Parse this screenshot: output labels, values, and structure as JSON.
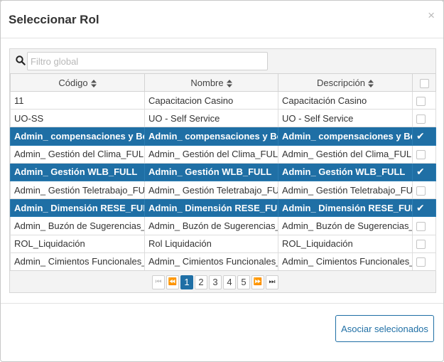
{
  "dialog": {
    "title": "Seleccionar Rol",
    "close_glyph": "×"
  },
  "filter": {
    "placeholder": "Filtro global",
    "icon": "search-icon"
  },
  "table": {
    "columns": [
      "Código",
      "Nombre",
      "Descripción"
    ],
    "rows": [
      {
        "codigo": "11",
        "nombre": "Capacitacion Casino",
        "descripcion": "Capacitación Casino",
        "selected": false
      },
      {
        "codigo": "UO-SS",
        "nombre": "UO - Self Service",
        "descripcion": "UO - Self Service",
        "selected": false
      },
      {
        "codigo": "Admin_ compensaciones y Bene",
        "nombre": "Admin_ compensaciones y Bene",
        "descripcion": "Admin_ compensaciones y Bene",
        "selected": true
      },
      {
        "codigo": "Admin_ Gestión del Clima_FULL",
        "nombre": "Admin_ Gestión del Clima_FULL",
        "descripcion": "Admin_ Gestión del Clima_FULL",
        "selected": false
      },
      {
        "codigo": "Admin_ Gestión WLB_FULL",
        "nombre": "Admin_ Gestión WLB_FULL",
        "descripcion": "Admin_ Gestión WLB_FULL",
        "selected": true
      },
      {
        "codigo": "Admin_ Gestión Teletrabajo_FUL",
        "nombre": "Admin_ Gestión Teletrabajo_FUL",
        "descripcion": "Admin_ Gestión Teletrabajo_FUL",
        "selected": false
      },
      {
        "codigo": "Admin_ Dimensión RESE_FULL",
        "nombre": "Admin_ Dimensión RESE_FULL",
        "descripcion": "Admin_ Dimensión RESE_FULL",
        "selected": true
      },
      {
        "codigo": "Admin_ Buzón de Sugerencias_F",
        "nombre": "Admin_ Buzón de Sugerencias_F",
        "descripcion": "Admin_ Buzón de Sugerencias_F",
        "selected": false
      },
      {
        "codigo": "ROL_Liquidación",
        "nombre": "Rol Liquidación",
        "descripcion": "ROL_Liquidación",
        "selected": false
      },
      {
        "codigo": "Admin_ Cimientos Funcionales_F",
        "nombre": "Admin_ Cimientos Funcionales_F",
        "descripcion": "Admin_ Cimientos Funcionales_F",
        "selected": false
      }
    ]
  },
  "paginator": {
    "pages": [
      "1",
      "2",
      "3",
      "4",
      "5"
    ],
    "current_page": "1"
  },
  "footer": {
    "associate_label": "Asociar selecionados"
  },
  "colors": {
    "accent": "#1f6fa5",
    "header_bg": "#f5f5f5"
  }
}
